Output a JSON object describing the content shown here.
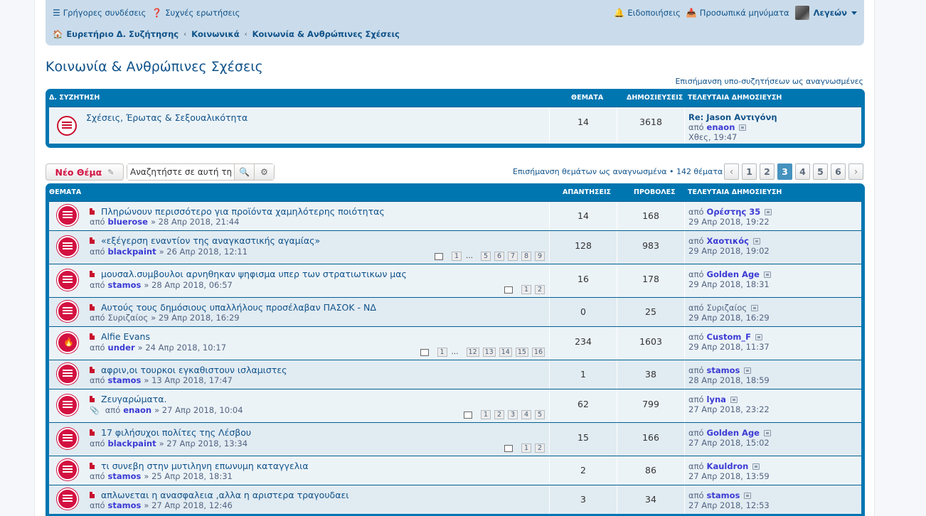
{
  "navbar": {
    "quick_links": "Γρήγορες συνδέσεις",
    "faq": "Συχνές ερωτήσεις",
    "notifications": "Ειδοποιήσεις",
    "messages": "Προσωπικά μηνύματα",
    "username": "Λεγεών",
    "breadcrumbs": [
      "Ευρετήριο Δ. Συζήτησης",
      "Κοινωνικά",
      "Κοινωνία & Ανθρώπινες Σχέσεις"
    ]
  },
  "page_title": "Κοινωνία & Ανθρώπινες Σχέσεις",
  "mark_subforums": "Επισήμανση υπο-συζητήσεων ως αναγνωσμένες",
  "forums_header": {
    "title": "Δ. ΣΥΖΗΤΗΣΗ",
    "topics": "ΘΕΜΑΤΑ",
    "posts": "ΔΗΜΟΣΙΕΥΣΕΙΣ",
    "last": "ΤΕΛΕΥΤΑΙΑ ΔΗΜΟΣΙΕΥΣΗ"
  },
  "subforum": {
    "title": "Σχέσεις, Έρωτας & Σεξουαλικότητα",
    "topics": "14",
    "posts": "3618",
    "last_title": "Re: Jason Αντιγόνη",
    "by": "από",
    "last_user": "enaon",
    "last_time": "Χθες, 19:47"
  },
  "actions": {
    "new_topic": "Νέο Θέμα",
    "search_placeholder": "Αναζητήστε σε αυτή τη",
    "search_value": "Αναζητήστε σε αυτή τη",
    "mark_topics": "Επισήμανση θεμάτων ως αναγνωσμένα • 142 θέματα",
    "pages": [
      "1",
      "2",
      "3",
      "4",
      "5",
      "6"
    ],
    "current_page": "3"
  },
  "topics_header": {
    "title": "ΘΕΜΑΤΑ",
    "replies": "ΑΠΑΝΤΗΣΕΙΣ",
    "views": "ΠΡΟΒΟΛΕΣ",
    "last": "ΤΕΛΕΥΤΑΙΑ ΔΗΜΟΣΙΕΥΣΗ"
  },
  "topics": [
    {
      "title": "Πληρώνουν περισσότερο για προϊόντα χαμηλότερης ποιότητας",
      "by": "από",
      "author": "bluerose",
      "date": "» 28 Απρ 2018, 21:44",
      "replies": "14",
      "views": "168",
      "last_user": "Ορέστης 35",
      "last_time": "29 Απρ 2018, 19:22",
      "pages": []
    },
    {
      "title": "«εξέγερση εναντίον της αναγκαστικής αγαμίας»",
      "by": "από",
      "author": "blackpaint",
      "date": "» 26 Απρ 2018, 12:11",
      "replies": "128",
      "views": "983",
      "last_user": "Χαοτικός",
      "last_time": "29 Απρ 2018, 19:02",
      "pages": [
        "1",
        "…",
        "5",
        "6",
        "7",
        "8",
        "9"
      ]
    },
    {
      "title": "μουσαλ.συμβουλοι αρνηθηκαν ψηφισμα υπερ των στρατιωτικων μας",
      "by": "από",
      "author": "stamos",
      "date": "» 28 Απρ 2018, 06:57",
      "replies": "16",
      "views": "178",
      "last_user": "Golden Age",
      "last_time": "29 Απρ 2018, 18:31",
      "pages": [
        "1",
        "2"
      ]
    },
    {
      "title": "Αυτούς τους δημόσιους υπαλλήλους προσέλαβαν ΠΑΣΟΚ - ΝΔ",
      "by": "από",
      "author": "Συριζαίος",
      "date": "» 29 Απρ 2018, 16:29",
      "replies": "0",
      "views": "25",
      "last_user": "Συριζαίος",
      "last_time": "29 Απρ 2018, 16:29",
      "pages": []
    },
    {
      "title": "Alfie Evans",
      "by": "από",
      "author": "under",
      "date": "» 24 Απρ 2018, 10:17",
      "replies": "234",
      "views": "1603",
      "last_user": "Custom_F",
      "last_time": "29 Απρ 2018, 11:37",
      "pages": [
        "1",
        "…",
        "12",
        "13",
        "14",
        "15",
        "16"
      ]
    },
    {
      "title": "αφριν,οι τουρκοι εγκαθιστουν ισλαμιστες",
      "by": "από",
      "author": "stamos",
      "date": "» 13 Απρ 2018, 17:47",
      "replies": "1",
      "views": "38",
      "last_user": "stamos",
      "last_time": "28 Απρ 2018, 18:59",
      "pages": []
    },
    {
      "title": "Ζευγαρώματα.",
      "by": "από",
      "author": "enaon",
      "date": "» 27 Απρ 2018, 10:04",
      "replies": "62",
      "views": "799",
      "last_user": "lyna",
      "last_time": "27 Απρ 2018, 23:22",
      "pages": [
        "1",
        "2",
        "3",
        "4",
        "5"
      ]
    },
    {
      "title": "17 φιλήσυχοι πολίτες της Λέσβου",
      "by": "από",
      "author": "blackpaint",
      "date": "» 27 Απρ 2018, 13:34",
      "replies": "15",
      "views": "166",
      "last_user": "Golden Age",
      "last_time": "27 Απρ 2018, 15:02",
      "pages": [
        "1",
        "2"
      ]
    },
    {
      "title": "τι συνεβη στην μυτιληνη επωνυμη καταγγελια",
      "by": "από",
      "author": "stamos",
      "date": "» 25 Απρ 2018, 18:31",
      "replies": "2",
      "views": "86",
      "last_user": "Kauldron",
      "last_time": "27 Απρ 2018, 13:59",
      "pages": []
    },
    {
      "title": "απλωνεται η ανασφαλεια ,αλλα η αριστερα τραγουδαει",
      "by": "από",
      "author": "stamos",
      "date": "» 27 Απρ 2018, 12:46",
      "replies": "3",
      "views": "34",
      "last_user": "stamos",
      "last_time": "27 Απρ 2018, 12:53",
      "pages": []
    }
  ],
  "colors": {
    "accent": "#0076b1",
    "link": "#105289",
    "new_topic": "#d31141",
    "active_page": "#4692bf"
  }
}
